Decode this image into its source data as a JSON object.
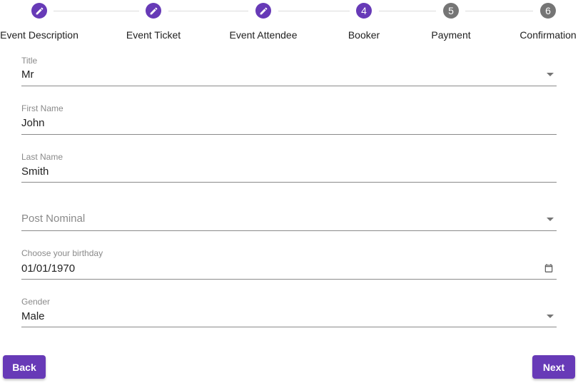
{
  "stepper": {
    "accent_color": "#673ab7",
    "pending_color": "#757575",
    "steps": [
      {
        "label": "Event Description",
        "state": "done",
        "icon": "pencil-icon"
      },
      {
        "label": "Event Ticket",
        "state": "done",
        "icon": "pencil-icon"
      },
      {
        "label": "Event Attendee",
        "state": "done",
        "icon": "pencil-icon"
      },
      {
        "label": "Booker",
        "state": "active",
        "number": "4"
      },
      {
        "label": "Payment",
        "state": "pending",
        "number": "5"
      },
      {
        "label": "Confirmation",
        "state": "pending",
        "number": "6"
      }
    ]
  },
  "form": {
    "title": {
      "label": "Title",
      "value": "Mr",
      "icon": "dropdown-arrow-icon"
    },
    "first_name": {
      "label": "First Name",
      "value": "John"
    },
    "last_name": {
      "label": "Last Name",
      "value": "Smith"
    },
    "post_nominal": {
      "placeholder": "Post Nominal",
      "icon": "dropdown-arrow-icon"
    },
    "birthday": {
      "label": "Choose your birthday",
      "value": "01/01/1970",
      "icon": "calendar-icon"
    },
    "gender": {
      "label": "Gender",
      "value": "Male",
      "icon": "dropdown-arrow-icon"
    }
  },
  "actions": {
    "back_label": "Back",
    "next_label": "Next"
  }
}
